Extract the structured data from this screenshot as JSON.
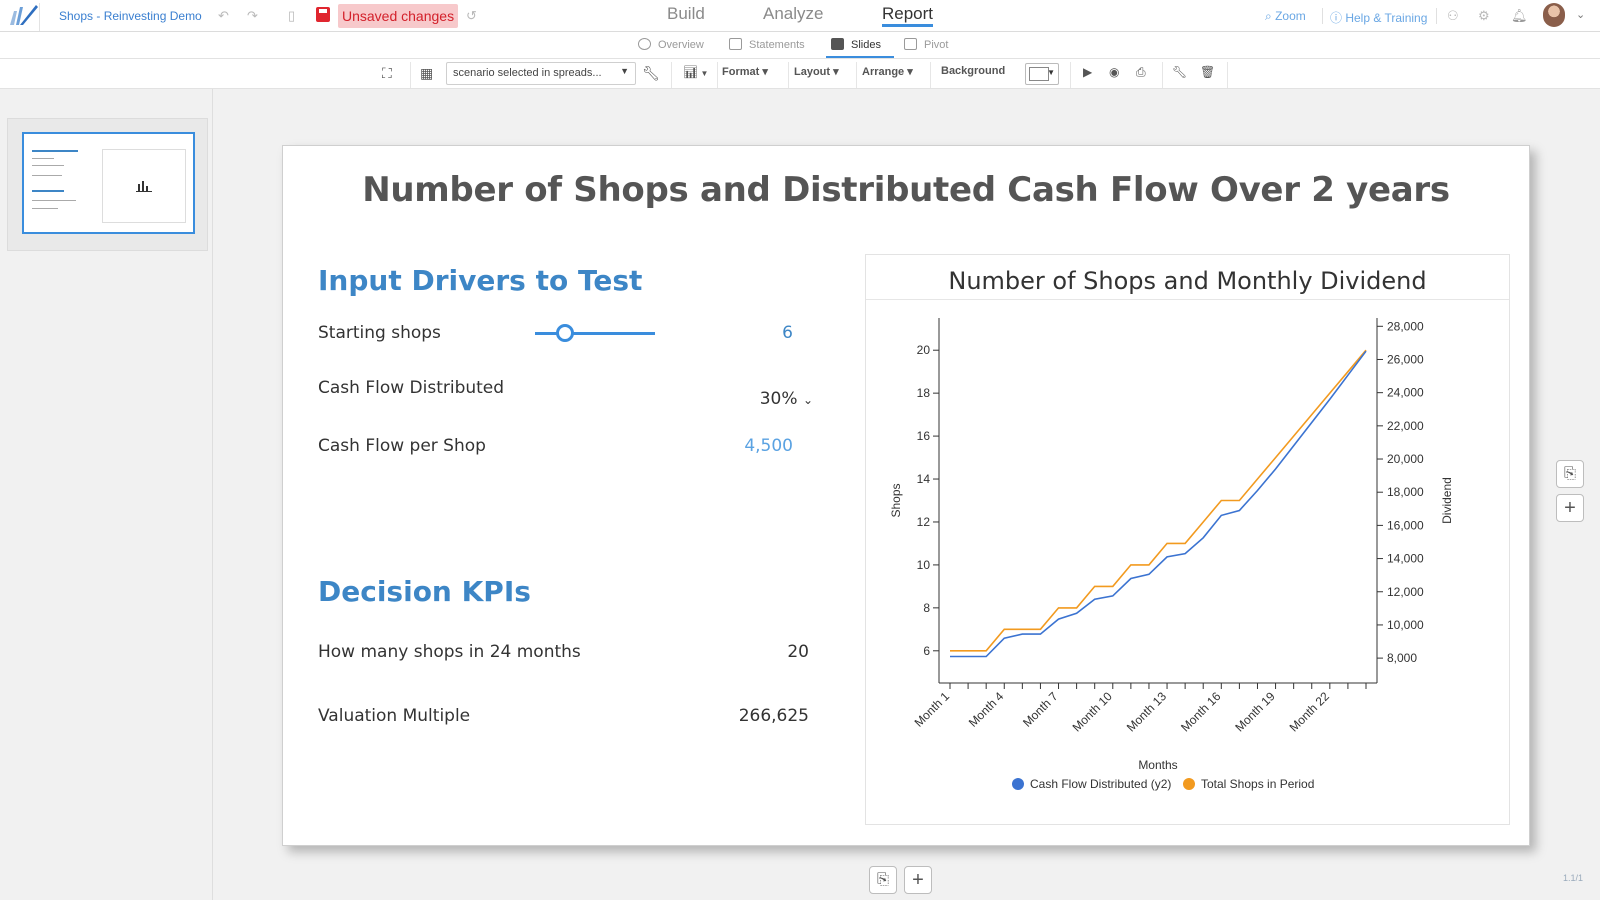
{
  "app": {
    "title": "Shops - Reinvesting Demo",
    "unsaved_label": "Unsaved changes"
  },
  "main_tabs": [
    "Build",
    "Analyze",
    "Report"
  ],
  "top_right": {
    "zoom": "Zoom",
    "help": "Help & Training"
  },
  "sub_tabs": [
    "Overview",
    "Statements",
    "Slides",
    "Pivot"
  ],
  "toolbar": {
    "scenario": "scenario selected in spreads...",
    "format": "Format",
    "layout": "Layout",
    "arrange": "Arrange",
    "background": "Background"
  },
  "slide": {
    "title": "Number of Shops and Distributed Cash Flow Over 2 years",
    "inputs_title": "Input Drivers to Test",
    "inputs": [
      {
        "label": "Starting shops",
        "value": "6",
        "slider_fraction": 0.25
      },
      {
        "label": "Cash Flow Distributed",
        "value": "30%"
      },
      {
        "label": "Cash Flow per Shop",
        "value": "4,500"
      }
    ],
    "kpis_title": "Decision KPIs",
    "kpis": [
      {
        "label": "How many shops in 24 months",
        "value": "20"
      },
      {
        "label": "Valuation Multiple",
        "value": "266,625"
      }
    ]
  },
  "pager": "1.1/1",
  "colors": {
    "accent": "#3a8ddd",
    "heading": "#3d86c6",
    "series_dividend": "#3b73d1",
    "series_shops": "#f29a1f",
    "unsaved_bg": "#f7c9cb",
    "unsaved_text": "#d3212b"
  },
  "chart_data": {
    "type": "line",
    "title": "Number of Shops and Monthly Dividend",
    "xlabel": "Months",
    "ylabel": "Shops",
    "y2label": "Dividend",
    "x": [
      "Month 1",
      "Month 2",
      "Month 3",
      "Month 4",
      "Month 5",
      "Month 6",
      "Month 7",
      "Month 8",
      "Month 9",
      "Month 10",
      "Month 11",
      "Month 12",
      "Month 13",
      "Month 14",
      "Month 15",
      "Month 16",
      "Month 17",
      "Month 18",
      "Month 19",
      "Month 20",
      "Month 21",
      "Month 22",
      "Month 23",
      "Month 24"
    ],
    "x_tick_labels": [
      "Month 1",
      "Month 4",
      "Month 7",
      "Month 10",
      "Month 13",
      "Month 16",
      "Month 19",
      "Month 22"
    ],
    "ylim": [
      4.5,
      21.5
    ],
    "yticks": [
      6,
      8,
      10,
      12,
      14,
      16,
      18,
      20
    ],
    "y2lim": [
      6500,
      28500
    ],
    "y2ticks": [
      8000,
      10000,
      12000,
      14000,
      16000,
      18000,
      20000,
      22000,
      24000,
      26000,
      28000
    ],
    "y2tick_labels": [
      "8,000",
      "10,000",
      "12,000",
      "14,000",
      "16,000",
      "18,000",
      "20,000",
      "22,000",
      "24,000",
      "26,000",
      "28,000"
    ],
    "legend_position": "bottom",
    "series": [
      {
        "name": "Cash Flow Distributed (y2)",
        "axis": "y2",
        "color": "#3b73d1",
        "values": [
          8100,
          8100,
          8100,
          9200,
          9450,
          9450,
          10350,
          10700,
          11550,
          11750,
          12800,
          13050,
          14100,
          14300,
          15250,
          16600,
          16900,
          18100,
          19400,
          20800,
          22200,
          23600,
          25050,
          26500
        ]
      },
      {
        "name": "Total Shops in Period",
        "axis": "y",
        "color": "#f29a1f",
        "values": [
          6,
          6,
          6,
          7,
          7,
          7,
          8,
          8,
          9,
          9,
          10,
          10,
          11,
          11,
          12,
          13,
          13,
          14,
          15,
          16,
          17,
          18,
          19,
          20
        ]
      }
    ]
  }
}
